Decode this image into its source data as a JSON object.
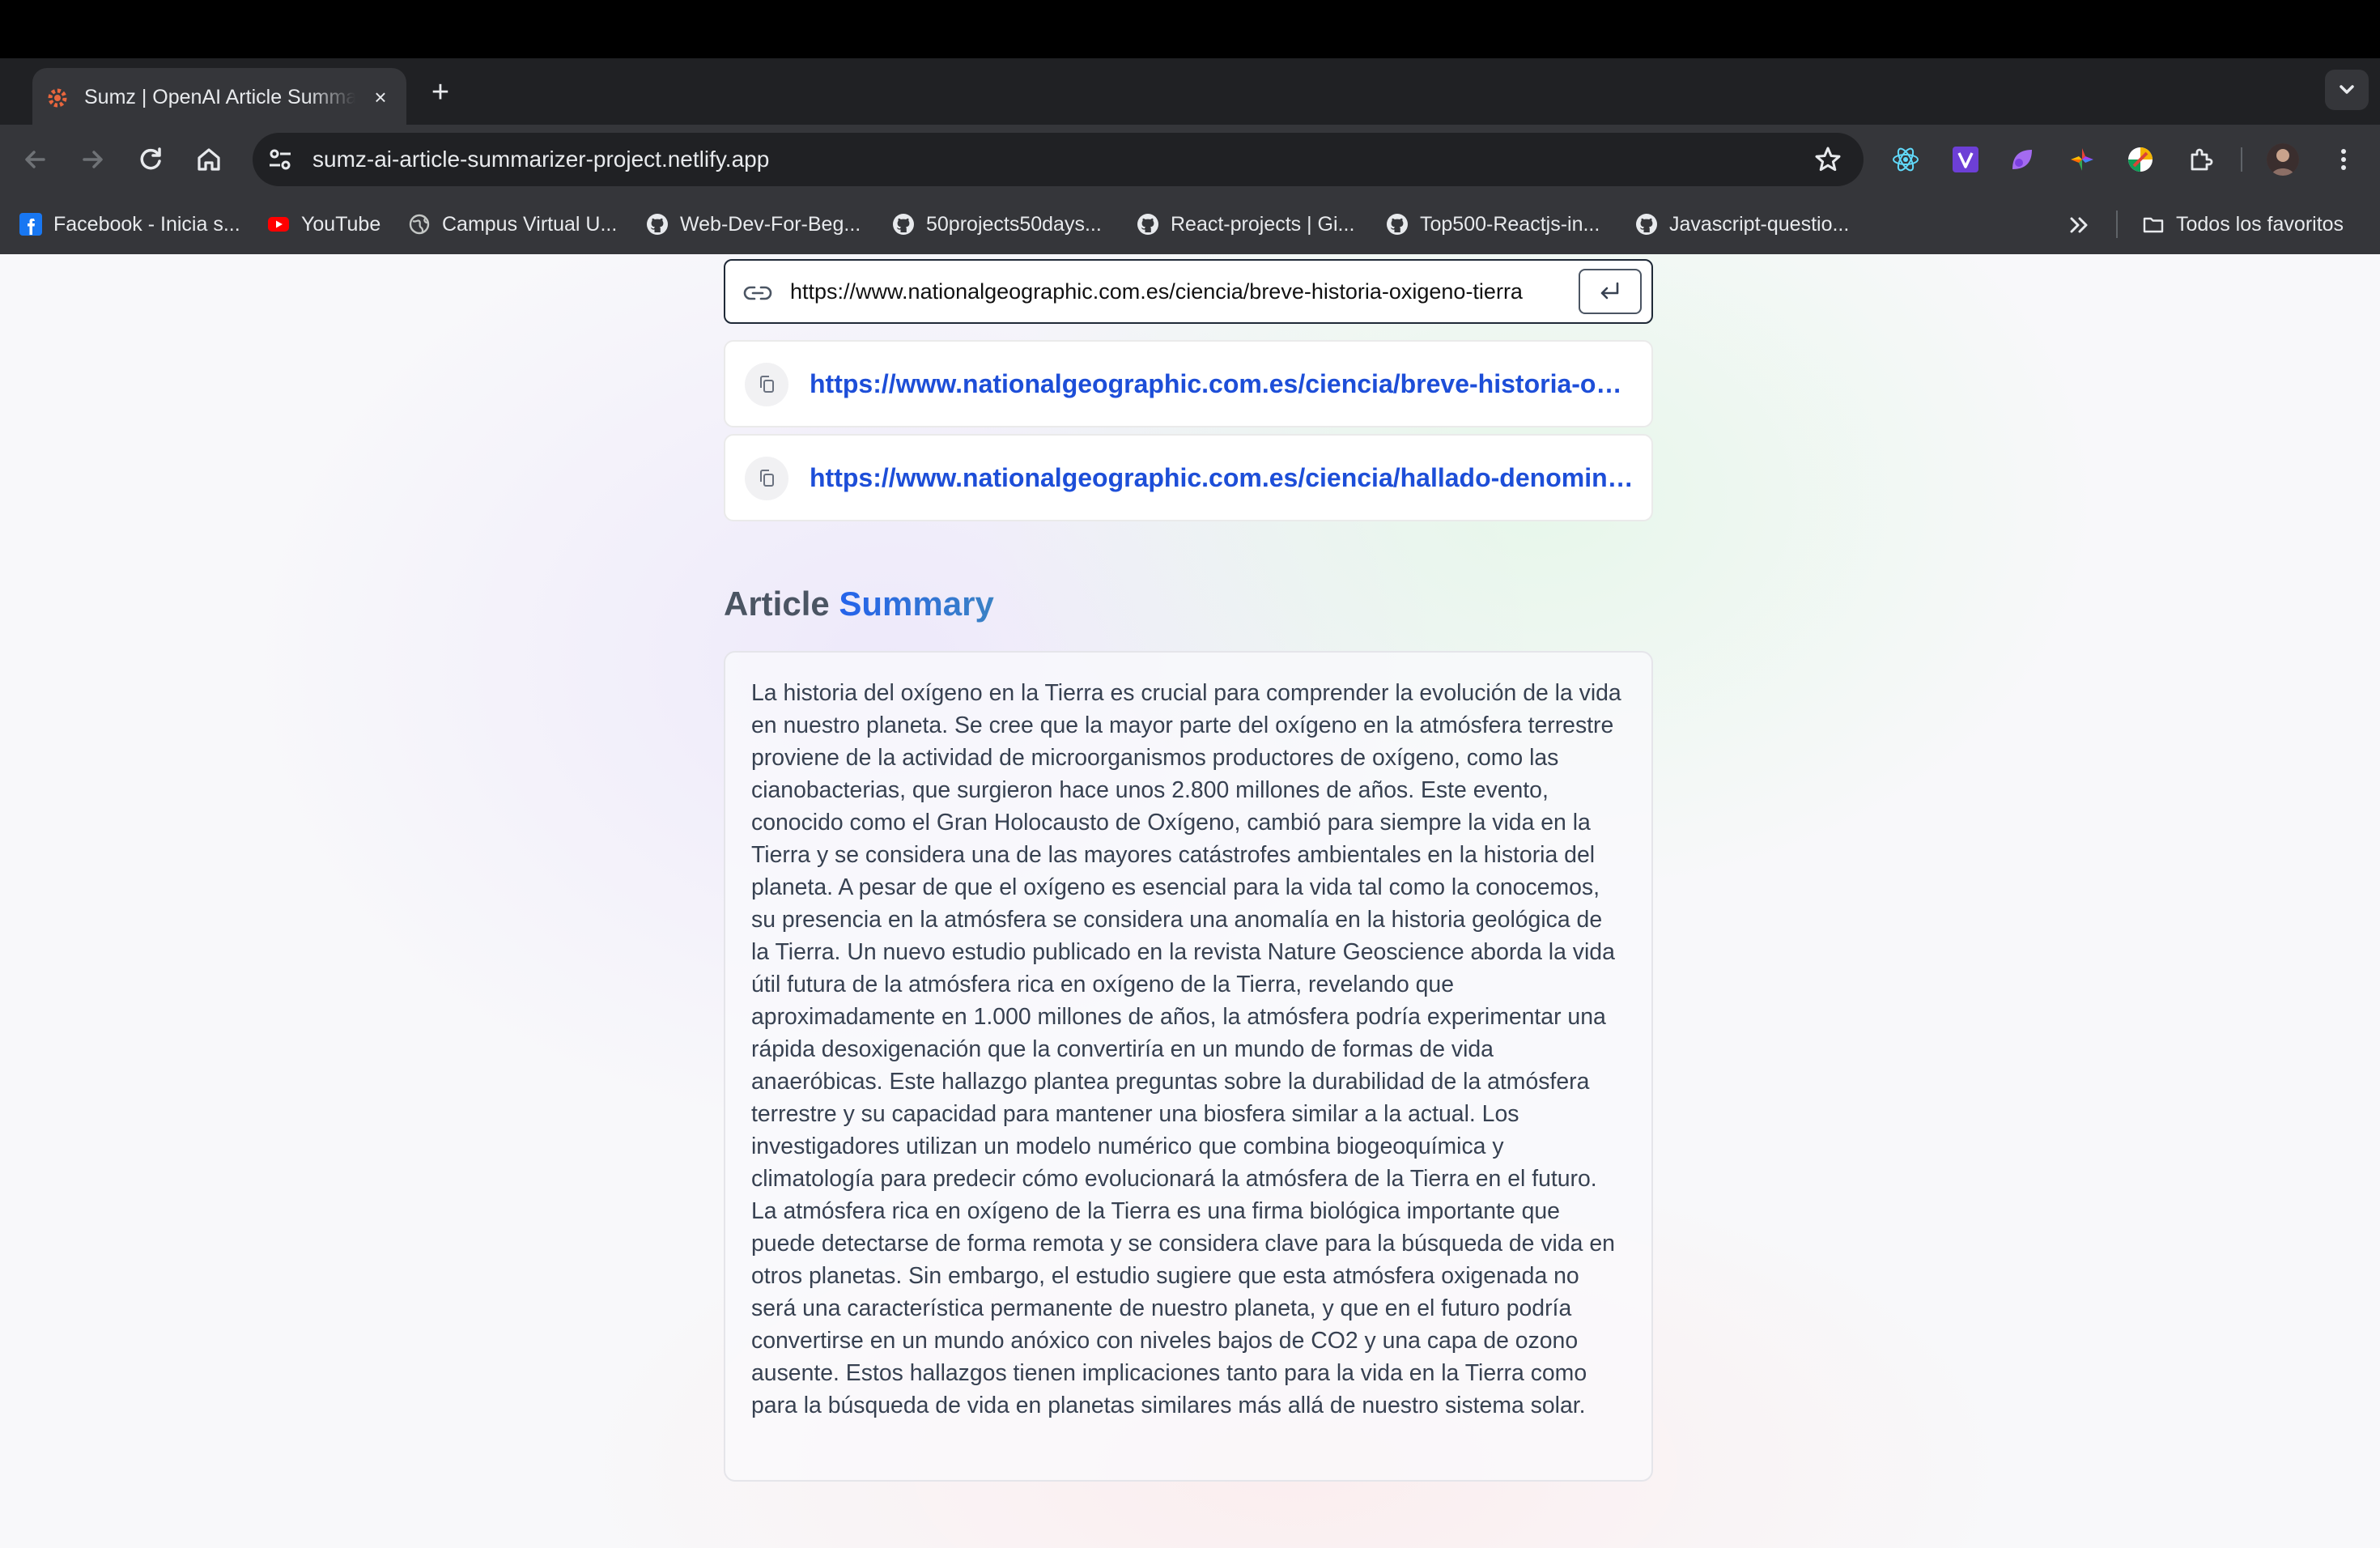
{
  "browser": {
    "tab": {
      "title": "Sumz | OpenAI Article Summarizer",
      "close_icon": "×"
    },
    "new_tab_icon": "+",
    "address": "sumz-ai-article-summarizer-project.netlify.app",
    "bookmarks": [
      {
        "label": "Facebook - Inicia s...",
        "icon": "facebook-icon"
      },
      {
        "label": "YouTube",
        "icon": "youtube-icon"
      },
      {
        "label": "Campus Virtual U...",
        "icon": "globe-icon"
      },
      {
        "label": "Web-Dev-For-Beg...",
        "icon": "github-icon"
      },
      {
        "label": "50projects50days...",
        "icon": "github-icon"
      },
      {
        "label": "React-projects | Gi...",
        "icon": "github-icon"
      },
      {
        "label": "Top500-Reactjs-in...",
        "icon": "github-icon"
      },
      {
        "label": "Javascript-questio...",
        "icon": "github-icon"
      }
    ],
    "all_bookmarks": "Todos los favoritos"
  },
  "app": {
    "url_input_value": "https://www.nationalgeographic.com.es/ciencia/breve-historia-oxigeno-tierra",
    "history": [
      "https://www.nationalgeographic.com.es/ciencia/breve-historia-oxigeno-tierra",
      "https://www.nationalgeographic.com.es/ciencia/hallado-denominado-"
    ],
    "summary_heading": "Article",
    "summary_heading_accent": "Summary",
    "summary_text": "La historia del oxígeno en la Tierra es crucial para comprender la evolución de la vida en nuestro planeta. Se cree que la mayor parte del oxígeno en la atmósfera terrestre proviene de la actividad de microorganismos productores de oxígeno, como las cianobacterias, que surgieron hace unos 2.800 millones de años. Este evento, conocido como el Gran Holocausto de Oxígeno, cambió para siempre la vida en la Tierra y se considera una de las mayores catástrofes ambientales en la historia del planeta. A pesar de que el oxígeno es esencial para la vida tal como la conocemos, su presencia en la atmósfera se considera una anomalía en la historia geológica de la Tierra. Un nuevo estudio publicado en la revista Nature Geoscience aborda la vida útil futura de la atmósfera rica en oxígeno de la Tierra, revelando que aproximadamente en 1.000 millones de años, la atmósfera podría experimentar una rápida desoxigenación que la convertiría en un mundo de formas de vida anaeróbicas. Este hallazgo plantea preguntas sobre la durabilidad de la atmósfera terrestre y su capacidad para mantener una biosfera similar a la actual. Los investigadores utilizan un modelo numérico que combina biogeoquímica y climatología para predecir cómo evolucionará la atmósfera de la Tierra en el futuro. La atmósfera rica en oxígeno de la Tierra es una firma biológica importante que puede detectarse de forma remota y se considera clave para la búsqueda de vida en otros planetas. Sin embargo, el estudio sugiere que esta atmósfera oxigenada no será una característica permanente de nuestro planeta, y que en el futuro podría convertirse en un mundo anóxico con niveles bajos de CO2 y una capa de ozono ausente. Estos hallazgos tienen implicaciones tanto para la vida en la Tierra como para la búsqueda de vida en planetas similares más allá de nuestro sistema solar."
  }
}
